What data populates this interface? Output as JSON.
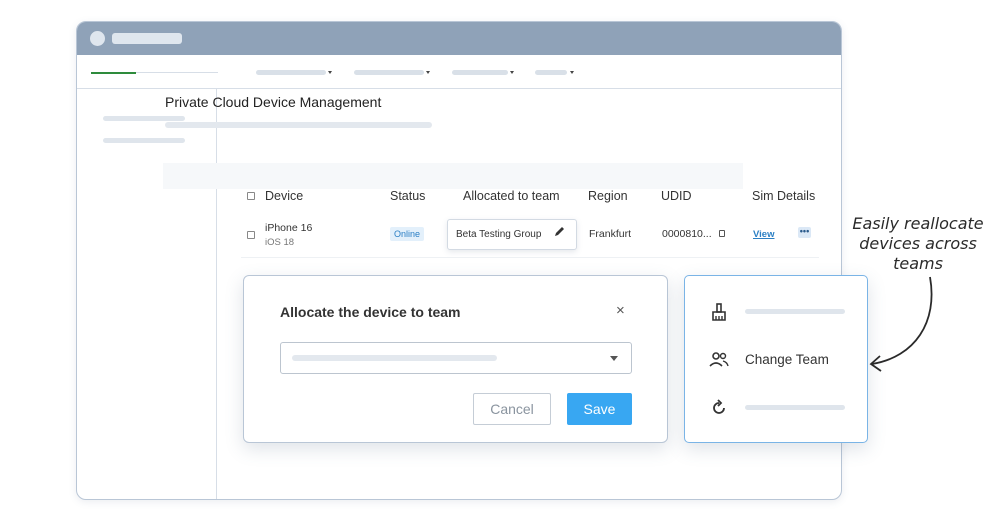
{
  "page": {
    "title": "Private Cloud Device Management"
  },
  "table": {
    "headers": [
      "Device",
      "Status",
      "Allocated to team",
      "Region",
      "UDID",
      "Sim Details"
    ],
    "row": {
      "device_name": "iPhone 16",
      "device_os": "iOS 18",
      "status": "Online",
      "team": "Beta Testing Group",
      "region": "Frankfurt",
      "udid": "0000810...",
      "sim_link": "View",
      "more_label": "•••"
    }
  },
  "modal": {
    "title": "Allocate the device to team",
    "close_label": "×",
    "cancel_label": "Cancel",
    "save_label": "Save"
  },
  "popup_menu": {
    "change_team_label": "Change Team",
    "icons": [
      "broom-icon",
      "users-icon",
      "refresh-icon"
    ]
  },
  "annotation": {
    "text": "Easily reallocate devices across teams"
  },
  "colors": {
    "titlebar": "#8fa2b8",
    "accent": "#38a7f2",
    "active_nav": "#2e8b3c",
    "link": "#2b7fc4"
  }
}
